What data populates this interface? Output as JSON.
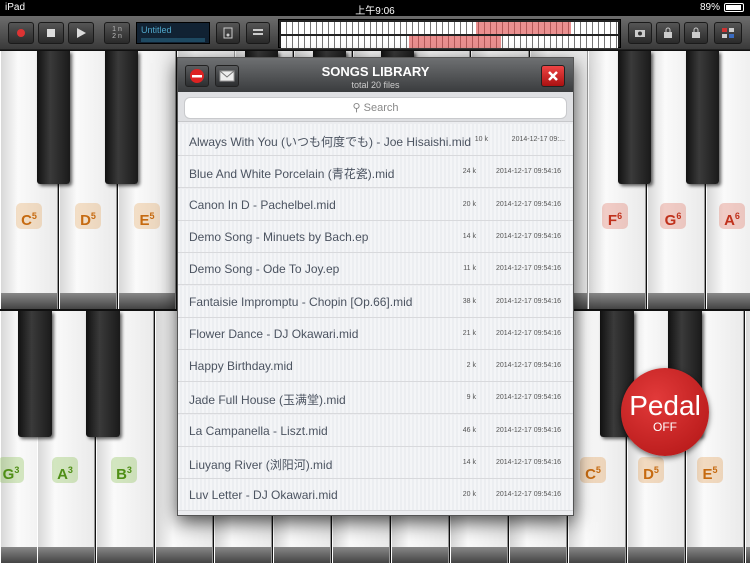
{
  "status_bar": {
    "device": "iPad",
    "time": "上午9:06",
    "battery": "89%"
  },
  "toolbar": {
    "track_label": "Untitled",
    "channel_top": "1 n",
    "channel_bottom": "2 n"
  },
  "upper_piano": {
    "notes": [
      "C",
      "D",
      "E",
      "F",
      "G",
      "A"
    ],
    "octaves": [
      "5",
      "5",
      "5",
      "6",
      "6",
      "6"
    ]
  },
  "lower_piano": {
    "notes": [
      "G",
      "A",
      "B",
      "C",
      "D",
      "E"
    ],
    "octaves": [
      "3",
      "3",
      "3",
      "5",
      "5",
      "5"
    ]
  },
  "pedal": {
    "label": "Pedal",
    "state": "OFF"
  },
  "dialog": {
    "title": "SONGS LIBRARY",
    "subtitle": "total 20 files",
    "search_placeholder": "Search",
    "songs": [
      {
        "name": "Always With You (いつも何度でも) - Joe Hisaishi.mid",
        "size": "10 k",
        "date": "2014-12-17 09:..."
      },
      {
        "name": "Blue And White Porcelain (青花瓷).mid",
        "size": "24 k",
        "date": "2014-12-17 09:54:16"
      },
      {
        "name": "Canon In D - Pachelbel.mid",
        "size": "20 k",
        "date": "2014-12-17 09:54:16"
      },
      {
        "name": "Demo Song - Minuets by Bach.ep",
        "size": "14 k",
        "date": "2014-12-17 09:54:16"
      },
      {
        "name": "Demo Song - Ode To Joy.ep",
        "size": "11 k",
        "date": "2014-12-17 09:54:16"
      },
      {
        "name": "Fantaisie Impromptu - Chopin [Op.66].mid",
        "size": "38 k",
        "date": "2014-12-17 09:54:16"
      },
      {
        "name": "Flower Dance - DJ Okawari.mid",
        "size": "21 k",
        "date": "2014-12-17 09:54:16"
      },
      {
        "name": "Happy Birthday.mid",
        "size": "2 k",
        "date": "2014-12-17 09:54:16"
      },
      {
        "name": "Jade Full House (玉满堂).mid",
        "size": "9 k",
        "date": "2014-12-17 09:54:16"
      },
      {
        "name": "La Campanella - Liszt.mid",
        "size": "46 k",
        "date": "2014-12-17 09:54:16"
      },
      {
        "name": "Liuyang River (浏阳河).mid",
        "size": "14 k",
        "date": "2014-12-17 09:54:16"
      },
      {
        "name": "Luv Letter - DJ Okawari.mid",
        "size": "20 k",
        "date": "2014-12-17 09:54:16"
      }
    ]
  },
  "colors": {
    "note_orange": "#e08a2a",
    "note_green": "#6fb52a",
    "note_red": "#d9432b",
    "pedal_red": "#c41f1f"
  }
}
